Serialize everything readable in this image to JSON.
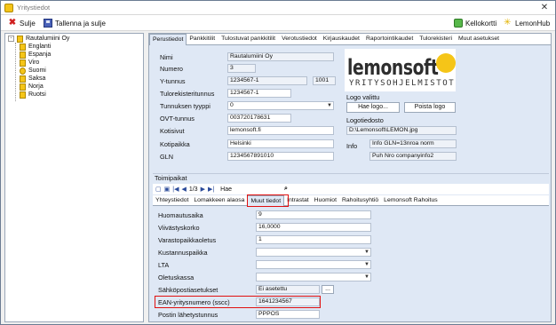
{
  "window": {
    "title": "Yritystiedot",
    "close_glyph": "✕"
  },
  "toolbar": {
    "close_label": "Sulje",
    "save_close_label": "Tallenna ja sulje",
    "kellokortti_label": "Kellokortti",
    "lemonhub_label": "LemonHub"
  },
  "tree": {
    "root": "Rautalumiini Oy",
    "root_expander": "-",
    "items": [
      "Englanti",
      "Espanja",
      "Viro",
      "Suomi",
      "Saksa",
      "Norja",
      "Ruotsi"
    ]
  },
  "tabs": [
    "Perustiedot",
    "Pankkitilit",
    "Tulostuvat pankkitilit",
    "Verotustiedot",
    "Kirjauskaudet",
    "Raportointikaudet",
    "Tulorekisteri",
    "Muut asetukset"
  ],
  "fields": {
    "nimi": {
      "label": "Nimi",
      "value": "Rautalumiini Oy"
    },
    "numero": {
      "label": "Numero",
      "value": "3"
    },
    "ytunnus": {
      "label": "Y-tunnus",
      "value": "1234567-1",
      "extra": "1001"
    },
    "tulorekisteritunnus": {
      "label": "Tulorekisteritunnus",
      "value": "1234567-1"
    },
    "tunnuksen_tyyppi": {
      "label": "Tunnuksen tyyppi",
      "value": "0"
    },
    "ovt": {
      "label": "OVT-tunnus",
      "value": "003720178631"
    },
    "kotisivut": {
      "label": "Kotisivut",
      "value": "lemonsoft.fi"
    },
    "kotipaikka": {
      "label": "Kotipaikka",
      "value": "Helsinki"
    },
    "gln": {
      "label": "GLN",
      "value": "1234567891010"
    }
  },
  "logo": {
    "word": "lemonsoft",
    "tagline": "YRITYSOHJELMISTOT",
    "valittu_label": "Logo valittu",
    "hae_button": "Hae logo...",
    "poista_button": "Poista logo",
    "logotiedosto_label": "Logotiedosto",
    "logotiedosto_value": "D:\\Lemonsoft\\LEMON.jpg",
    "info_label": "Info",
    "info_value1": "Info GLN=13nroa norm",
    "info_value2": "Puh Nro companyinfo2"
  },
  "toimipaikat": {
    "label": "Toimipaikat",
    "page_indicator": "1/3",
    "search_label": "Hae",
    "binoculars": "⌕"
  },
  "subtabs": [
    "Yhteystiedot",
    "Lomakkeen alaosa",
    "Muut tiedot",
    "Intrastat",
    "Huomiot",
    "Rahoitusyhtiö",
    "Lemonsoft Rahoitus"
  ],
  "muut": {
    "huomautusaika": {
      "label": "Huomautusaika",
      "value": "9"
    },
    "viivastyskorko": {
      "label": "Viivästyskorko",
      "value": "16,0000"
    },
    "varasto": {
      "label": "Varastopaikkaoletus",
      "value": "1"
    },
    "kustannuspaikka": {
      "label": "Kustannuspaikka",
      "value": ""
    },
    "lta": {
      "label": "LTA",
      "value": ""
    },
    "oletuskassa": {
      "label": "Oletuskassa",
      "value": ""
    },
    "sahkoposti": {
      "label": "Sähköpostiasetukset",
      "value": "Ei asetettu",
      "button": "..."
    },
    "ean": {
      "label": "EAN-yritysnumero (sscc)",
      "value": "1641234567"
    },
    "postin": {
      "label": "Postin lähetystunnus",
      "value": "PPPOS"
    }
  },
  "colors": {
    "accent_red": "#e01010",
    "panel_blue": "#dfe8f5",
    "lemon_yellow": "#f5c518"
  }
}
